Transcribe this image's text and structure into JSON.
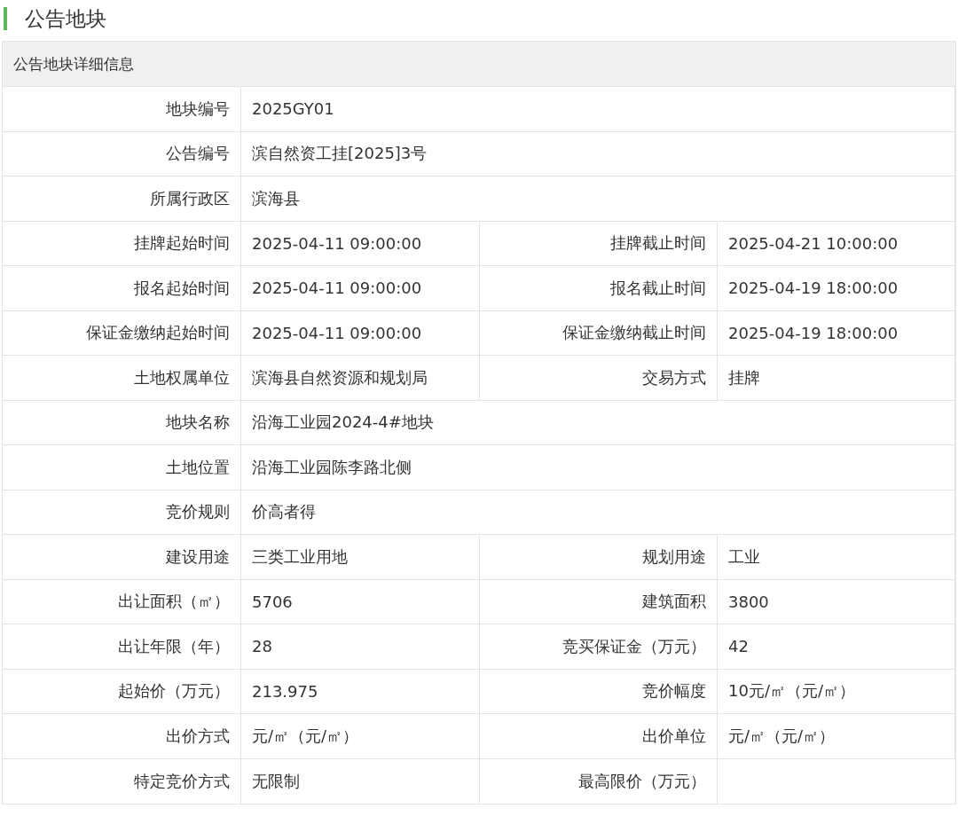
{
  "section_title": "公告地块",
  "table": {
    "title": "公告地块详细信息",
    "rows": [
      [
        {
          "label": "地块编号",
          "value": "2025GY01"
        }
      ],
      [
        {
          "label": "公告编号",
          "value": "滨自然资工挂[2025]3号"
        }
      ],
      [
        {
          "label": "所属行政区",
          "value": "滨海县"
        }
      ],
      [
        {
          "label": "挂牌起始时间",
          "value": "2025-04-11 09:00:00"
        },
        {
          "label": "挂牌截止时间",
          "value": "2025-04-21 10:00:00"
        }
      ],
      [
        {
          "label": "报名起始时间",
          "value": "2025-04-11 09:00:00"
        },
        {
          "label": "报名截止时间",
          "value": "2025-04-19 18:00:00"
        }
      ],
      [
        {
          "label": "保证金缴纳起始时间",
          "value": "2025-04-11 09:00:00"
        },
        {
          "label": "保证金缴纳截止时间",
          "value": "2025-04-19 18:00:00"
        }
      ],
      [
        {
          "label": "土地权属单位",
          "value": "滨海县自然资源和规划局"
        },
        {
          "label": "交易方式",
          "value": "挂牌"
        }
      ],
      [
        {
          "label": "地块名称",
          "value": "沿海工业园2024-4#地块"
        }
      ],
      [
        {
          "label": "土地位置",
          "value": "沿海工业园陈李路北侧"
        }
      ],
      [
        {
          "label": "竞价规则",
          "value": "价高者得"
        }
      ],
      [
        {
          "label": "建设用途",
          "value": "三类工业用地"
        },
        {
          "label": "规划用途",
          "value": "工业"
        }
      ],
      [
        {
          "label": "出让面积（㎡）",
          "value": "5706"
        },
        {
          "label": "建筑面积",
          "value": "3800"
        }
      ],
      [
        {
          "label": "出让年限（年）",
          "value": "28"
        },
        {
          "label": "竞买保证金（万元）",
          "value": "42"
        }
      ],
      [
        {
          "label": "起始价（万元）",
          "value": "213.975"
        },
        {
          "label": "竞价幅度",
          "value": "10元/㎡（元/㎡）"
        }
      ],
      [
        {
          "label": "出价方式",
          "value": "元/㎡（元/㎡）"
        },
        {
          "label": "出价单位",
          "value": "元/㎡（元/㎡）"
        }
      ],
      [
        {
          "label": "特定竞价方式",
          "value": "无限制"
        },
        {
          "label": "最高限价（万元）"
        }
      ]
    ]
  }
}
